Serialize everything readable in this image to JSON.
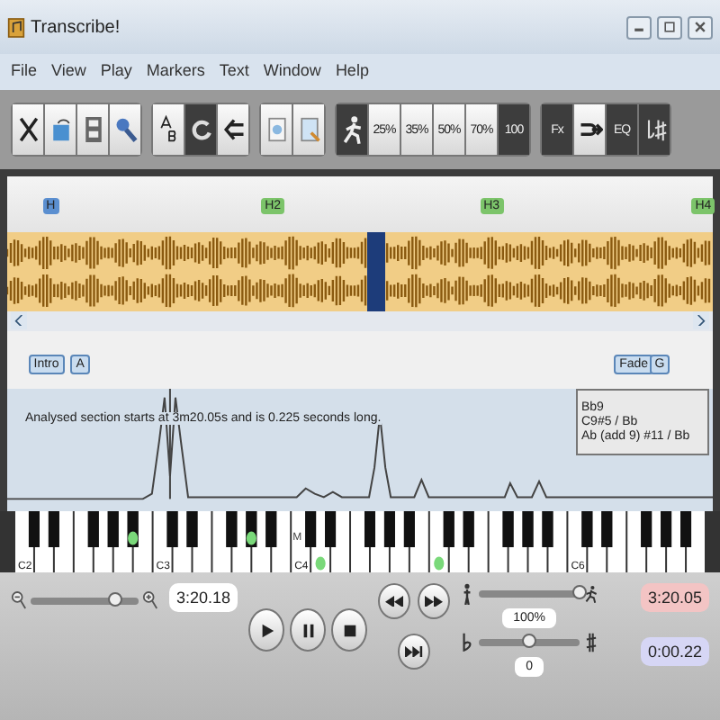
{
  "window": {
    "title": "Transcribe!"
  },
  "menu": [
    "File",
    "View",
    "Play",
    "Markers",
    "Text",
    "Window",
    "Help"
  ],
  "toolbar": [
    {
      "buttons": [
        {
          "kind": "icon",
          "selected": false
        },
        {
          "kind": "icon",
          "selected": false
        },
        {
          "kind": "icon",
          "selected": false
        },
        {
          "kind": "icon",
          "selected": false
        }
      ]
    },
    {
      "buttons": [
        {
          "kind": "icon",
          "selected": false
        },
        {
          "kind": "icon",
          "selected": true
        },
        {
          "kind": "icon",
          "selected": false
        }
      ]
    },
    {
      "buttons": [
        {
          "kind": "icon",
          "selected": false
        },
        {
          "kind": "icon",
          "selected": false
        }
      ]
    },
    {
      "buttons": [
        {
          "kind": "icon",
          "selected": true
        },
        {
          "kind": "text",
          "label": "25%",
          "selected": false
        },
        {
          "kind": "text",
          "label": "35%",
          "selected": false
        },
        {
          "kind": "text",
          "label": "50%",
          "selected": false
        },
        {
          "kind": "text",
          "label": "70%",
          "selected": false
        },
        {
          "kind": "text",
          "label": "100",
          "selected": true
        }
      ]
    },
    {
      "buttons": [
        {
          "kind": "text",
          "label": "Fx",
          "selected": true
        },
        {
          "kind": "icon",
          "selected": false
        },
        {
          "kind": "text",
          "label": "EQ",
          "selected": true
        },
        {
          "kind": "icon",
          "selected": true
        }
      ]
    }
  ],
  "bar_markers": [
    {
      "label": "H",
      "color": "#5b8fd0"
    },
    {
      "label": "H2",
      "color": "#7cc46a"
    },
    {
      "label": "H3",
      "color": "#7cc46a"
    },
    {
      "label": "H4",
      "color": "#7cc46a"
    }
  ],
  "section_markers": [
    "Intro",
    "A",
    "Fade",
    "G"
  ],
  "analysis": {
    "text": "Analysed section starts at 3m20.05s and is 0.225 seconds long.",
    "chords": [
      "Bb9",
      "C9#5 / Bb",
      "Ab (add 9) #11 / Bb"
    ]
  },
  "piano": {
    "middle_mark": "M",
    "octaves": [
      {
        "label": "C2",
        "active": [
          false,
          false,
          false,
          false,
          false,
          false,
          false,
          false,
          false,
          false,
          true,
          false
        ]
      },
      {
        "label": "C3",
        "active": [
          false,
          false,
          false,
          false,
          false,
          false,
          false,
          false,
          true,
          false,
          false,
          false
        ]
      },
      {
        "label": "C4",
        "active": [
          false,
          false,
          true,
          false,
          false,
          false,
          false,
          false,
          false,
          false,
          false,
          false
        ]
      },
      {
        "active": [
          true,
          false,
          false,
          false,
          false,
          false,
          false,
          false,
          false,
          false,
          false,
          false
        ]
      },
      {
        "label": "C6",
        "active": [
          false,
          false,
          false,
          false,
          false,
          false,
          false,
          false,
          false,
          false,
          false,
          false
        ]
      }
    ]
  },
  "controls": {
    "zoom": {
      "level": 0.78
    },
    "position": "3:20.18",
    "speed": {
      "level": 1.0,
      "reading": "100%"
    },
    "pitch": {
      "level": 0.5,
      "reading": "0"
    },
    "start_time": "3:20.05",
    "length": "0:00.22"
  }
}
